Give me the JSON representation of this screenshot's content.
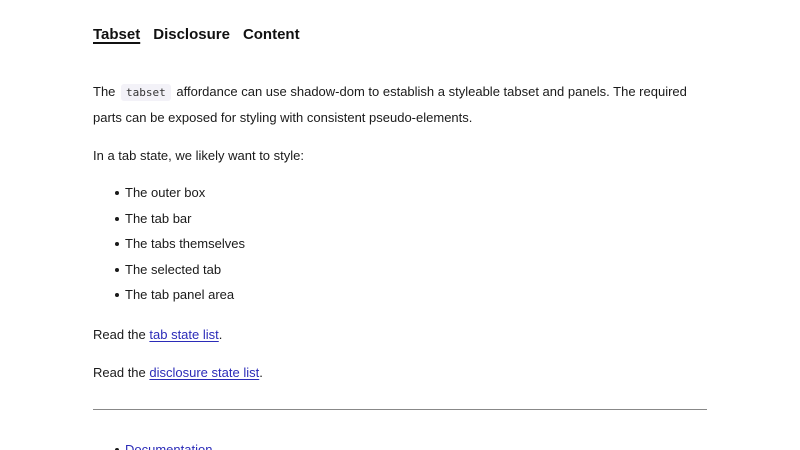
{
  "nav": {
    "tabs": [
      {
        "label": "Tabset",
        "selected": true
      },
      {
        "label": "Disclosure",
        "selected": false
      },
      {
        "label": "Content",
        "selected": false
      }
    ]
  },
  "intro": {
    "before_code": "The",
    "code": "tabset",
    "after_code": "affordance can use shadow-dom to establish a styleable tabset and panels. The required parts can be exposed for styling with consistent pseudo-elements."
  },
  "style_lead": "In a tab state, we likely want to style:",
  "style_items": [
    "The outer box",
    "The tab bar",
    "The tabs themselves",
    "The selected tab",
    "The tab panel area"
  ],
  "read_links": [
    {
      "prefix": "Read the",
      "link": "tab state list",
      "suffix": "."
    },
    {
      "prefix": "Read the",
      "link": "disclosure state list",
      "suffix": "."
    }
  ],
  "footer": {
    "links": [
      "Documentation"
    ]
  },
  "colors": {
    "link": "#2b2bb8",
    "text": "#1a1a1a",
    "divider": "#888888"
  }
}
